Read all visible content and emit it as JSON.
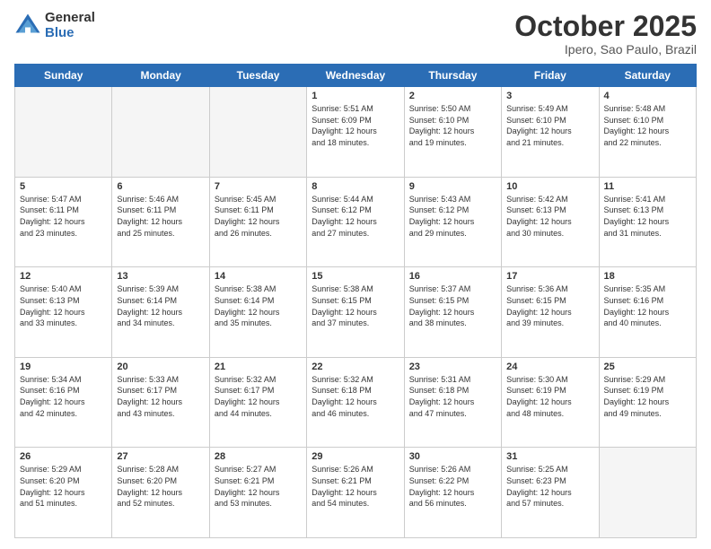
{
  "logo": {
    "general": "General",
    "blue": "Blue"
  },
  "title": {
    "month": "October 2025",
    "location": "Ipero, Sao Paulo, Brazil"
  },
  "weekdays": [
    "Sunday",
    "Monday",
    "Tuesday",
    "Wednesday",
    "Thursday",
    "Friday",
    "Saturday"
  ],
  "weeks": [
    [
      {
        "day": "",
        "info": ""
      },
      {
        "day": "",
        "info": ""
      },
      {
        "day": "",
        "info": ""
      },
      {
        "day": "1",
        "info": "Sunrise: 5:51 AM\nSunset: 6:09 PM\nDaylight: 12 hours\nand 18 minutes."
      },
      {
        "day": "2",
        "info": "Sunrise: 5:50 AM\nSunset: 6:10 PM\nDaylight: 12 hours\nand 19 minutes."
      },
      {
        "day": "3",
        "info": "Sunrise: 5:49 AM\nSunset: 6:10 PM\nDaylight: 12 hours\nand 21 minutes."
      },
      {
        "day": "4",
        "info": "Sunrise: 5:48 AM\nSunset: 6:10 PM\nDaylight: 12 hours\nand 22 minutes."
      }
    ],
    [
      {
        "day": "5",
        "info": "Sunrise: 5:47 AM\nSunset: 6:11 PM\nDaylight: 12 hours\nand 23 minutes."
      },
      {
        "day": "6",
        "info": "Sunrise: 5:46 AM\nSunset: 6:11 PM\nDaylight: 12 hours\nand 25 minutes."
      },
      {
        "day": "7",
        "info": "Sunrise: 5:45 AM\nSunset: 6:11 PM\nDaylight: 12 hours\nand 26 minutes."
      },
      {
        "day": "8",
        "info": "Sunrise: 5:44 AM\nSunset: 6:12 PM\nDaylight: 12 hours\nand 27 minutes."
      },
      {
        "day": "9",
        "info": "Sunrise: 5:43 AM\nSunset: 6:12 PM\nDaylight: 12 hours\nand 29 minutes."
      },
      {
        "day": "10",
        "info": "Sunrise: 5:42 AM\nSunset: 6:13 PM\nDaylight: 12 hours\nand 30 minutes."
      },
      {
        "day": "11",
        "info": "Sunrise: 5:41 AM\nSunset: 6:13 PM\nDaylight: 12 hours\nand 31 minutes."
      }
    ],
    [
      {
        "day": "12",
        "info": "Sunrise: 5:40 AM\nSunset: 6:13 PM\nDaylight: 12 hours\nand 33 minutes."
      },
      {
        "day": "13",
        "info": "Sunrise: 5:39 AM\nSunset: 6:14 PM\nDaylight: 12 hours\nand 34 minutes."
      },
      {
        "day": "14",
        "info": "Sunrise: 5:38 AM\nSunset: 6:14 PM\nDaylight: 12 hours\nand 35 minutes."
      },
      {
        "day": "15",
        "info": "Sunrise: 5:38 AM\nSunset: 6:15 PM\nDaylight: 12 hours\nand 37 minutes."
      },
      {
        "day": "16",
        "info": "Sunrise: 5:37 AM\nSunset: 6:15 PM\nDaylight: 12 hours\nand 38 minutes."
      },
      {
        "day": "17",
        "info": "Sunrise: 5:36 AM\nSunset: 6:15 PM\nDaylight: 12 hours\nand 39 minutes."
      },
      {
        "day": "18",
        "info": "Sunrise: 5:35 AM\nSunset: 6:16 PM\nDaylight: 12 hours\nand 40 minutes."
      }
    ],
    [
      {
        "day": "19",
        "info": "Sunrise: 5:34 AM\nSunset: 6:16 PM\nDaylight: 12 hours\nand 42 minutes."
      },
      {
        "day": "20",
        "info": "Sunrise: 5:33 AM\nSunset: 6:17 PM\nDaylight: 12 hours\nand 43 minutes."
      },
      {
        "day": "21",
        "info": "Sunrise: 5:32 AM\nSunset: 6:17 PM\nDaylight: 12 hours\nand 44 minutes."
      },
      {
        "day": "22",
        "info": "Sunrise: 5:32 AM\nSunset: 6:18 PM\nDaylight: 12 hours\nand 46 minutes."
      },
      {
        "day": "23",
        "info": "Sunrise: 5:31 AM\nSunset: 6:18 PM\nDaylight: 12 hours\nand 47 minutes."
      },
      {
        "day": "24",
        "info": "Sunrise: 5:30 AM\nSunset: 6:19 PM\nDaylight: 12 hours\nand 48 minutes."
      },
      {
        "day": "25",
        "info": "Sunrise: 5:29 AM\nSunset: 6:19 PM\nDaylight: 12 hours\nand 49 minutes."
      }
    ],
    [
      {
        "day": "26",
        "info": "Sunrise: 5:29 AM\nSunset: 6:20 PM\nDaylight: 12 hours\nand 51 minutes."
      },
      {
        "day": "27",
        "info": "Sunrise: 5:28 AM\nSunset: 6:20 PM\nDaylight: 12 hours\nand 52 minutes."
      },
      {
        "day": "28",
        "info": "Sunrise: 5:27 AM\nSunset: 6:21 PM\nDaylight: 12 hours\nand 53 minutes."
      },
      {
        "day": "29",
        "info": "Sunrise: 5:26 AM\nSunset: 6:21 PM\nDaylight: 12 hours\nand 54 minutes."
      },
      {
        "day": "30",
        "info": "Sunrise: 5:26 AM\nSunset: 6:22 PM\nDaylight: 12 hours\nand 56 minutes."
      },
      {
        "day": "31",
        "info": "Sunrise: 5:25 AM\nSunset: 6:23 PM\nDaylight: 12 hours\nand 57 minutes."
      },
      {
        "day": "",
        "info": ""
      }
    ]
  ]
}
